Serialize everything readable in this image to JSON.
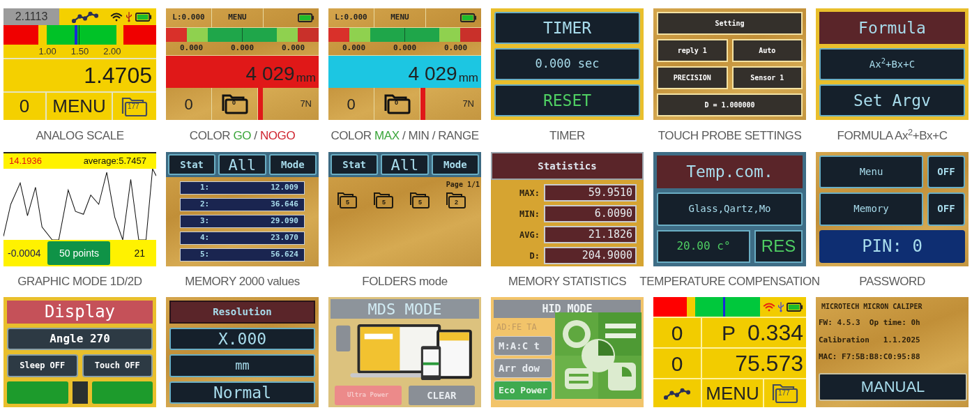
{
  "tiles": [
    {
      "kind": "analog",
      "readout": "2.1113",
      "scale_labels": [
        "1.00",
        "1.50",
        "2.00"
      ],
      "value": "1.4705",
      "zero": "0",
      "menu": "MENU",
      "folder": "177",
      "caption": [
        {
          "text": "ANALOG SCALE",
          "color": "#5b5b5b"
        }
      ]
    },
    {
      "kind": "nogo",
      "limit": "L:0.000",
      "menu": "MENU",
      "limits": [
        "0.000",
        "0.000",
        "0.000"
      ],
      "value": "4 029",
      "unit": "mm",
      "zero": "0",
      "folder": "0",
      "right": "7N",
      "caption": [
        {
          "text": "COLOR ",
          "color": "#5b5b5b"
        },
        {
          "text": "GO",
          "color": "#3aa53a"
        },
        {
          "text": " / ",
          "color": "#5b5b5b"
        },
        {
          "text": "NOGO",
          "color": "#cf2530"
        }
      ]
    },
    {
      "kind": "range",
      "limit": "L:0.000",
      "menu": "MENU",
      "limits": [
        "0.000",
        "0.000",
        "0.000"
      ],
      "value": "4 029",
      "unit": "mm",
      "zero": "0",
      "folder": "0",
      "right": "7N",
      "caption": [
        {
          "text": "COLOR ",
          "color": "#5b5b5b"
        },
        {
          "text": "MAX",
          "color": "#3aa53a"
        },
        {
          "text": " / MIN / RANGE",
          "color": "#5b5b5b"
        }
      ]
    },
    {
      "kind": "panel",
      "rows": [
        [
          {
            "text": "TIMER",
            "kind": "heading"
          }
        ],
        [
          {
            "text": "0.000 sec",
            "kind": "value"
          }
        ],
        [
          {
            "text": "RESET",
            "kind": "action"
          }
        ]
      ],
      "caption": [
        {
          "text": "TIMER",
          "color": "#5b5b5b"
        }
      ]
    },
    {
      "kind": "panel",
      "rows": [
        [
          {
            "text": "Setting",
            "kind": "plate"
          }
        ],
        [
          {
            "text": "reply 1",
            "kind": "plate"
          },
          {
            "text": "Auto",
            "kind": "plate"
          }
        ],
        [
          {
            "text": "PRECISION",
            "kind": "plate"
          },
          {
            "text": "Sensor 1",
            "kind": "plate"
          }
        ],
        [
          {
            "text": "D = 1.000000",
            "kind": "plate"
          }
        ]
      ],
      "caption": [
        {
          "text": "TOUCH PROBE SETTINGS",
          "color": "#5b5b5b"
        }
      ]
    },
    {
      "kind": "panel",
      "rows": [
        [
          {
            "text": "Formula",
            "kind": "banner"
          }
        ],
        [
          {
            "text": "Ax$^{2}$+Bx+C",
            "kind": "label"
          }
        ],
        [
          {
            "text": "Set Argv",
            "kind": "heading"
          }
        ]
      ],
      "caption": [
        {
          "text": "FORMULA Ax$^{2}$+Bx+C",
          "color": "#5b5b5b"
        }
      ]
    },
    {
      "kind": "graph",
      "max": "14.1936",
      "average": "average:5.7457",
      "min": "-0.0004",
      "points": "50 points",
      "count": "21",
      "caption": [
        {
          "text": "GRAPHIC MODE 1D/2D",
          "color": "#5b5b5b"
        }
      ]
    },
    {
      "kind": "memory",
      "header": [
        "Stat",
        "All",
        "Mode"
      ],
      "entries": [
        {
          "index": "1:",
          "value": "12.009"
        },
        {
          "index": "2:",
          "value": "36.646"
        },
        {
          "index": "3:",
          "value": "29.090"
        },
        {
          "index": "4:",
          "value": "23.070"
        },
        {
          "index": "5:",
          "value": "56.624"
        }
      ],
      "caption": [
        {
          "text": "MEMORY 2000 values",
          "color": "#5b5b5b"
        }
      ]
    },
    {
      "kind": "folders",
      "header": [
        "Stat",
        "All",
        "Mode"
      ],
      "page": "Page 1/1",
      "folders": [
        "5",
        "5",
        "5",
        "2"
      ],
      "caption": [
        {
          "text": "FOLDERS mode",
          "color": "#5b5b5b"
        }
      ]
    },
    {
      "kind": "stats",
      "title": "Statistics",
      "stats": [
        {
          "label": "MAX:",
          "value": "59.9510"
        },
        {
          "label": "MIN:",
          "value": "6.0090"
        },
        {
          "label": "AVG:",
          "value": "21.1826"
        },
        {
          "label": "D:",
          "value": "204.9000"
        }
      ],
      "caption": [
        {
          "text": "MEMORY STATISTICS",
          "color": "#5b5b5b"
        }
      ]
    },
    {
      "kind": "panel",
      "rows": [
        [
          {
            "text": "Temp.com.",
            "kind": "banner"
          }
        ],
        [
          {
            "text": "Glass,Qartz,Mo",
            "kind": "label"
          }
        ],
        [
          {
            "text": "20.00 c°",
            "kind": "reading"
          },
          {
            "text": "RES",
            "kind": "reset"
          }
        ]
      ],
      "caption": [
        {
          "text": "TEMPERATURE COMPENSATION",
          "color": "#5b5b5b"
        }
      ]
    },
    {
      "kind": "panel",
      "rows": [
        [
          {
            "text": "Menu",
            "kind": "label"
          },
          {
            "text": "OFF",
            "kind": "toggle"
          }
        ],
        [
          {
            "text": "Memory",
            "kind": "label"
          },
          {
            "text": "OFF",
            "kind": "toggle"
          }
        ],
        [
          {
            "text": "PIN: 0",
            "kind": "pin"
          }
        ]
      ],
      "caption": [
        {
          "text": "PASSWORD",
          "color": "#5b5b5b"
        }
      ]
    },
    {
      "kind": "panel",
      "rows": [
        [
          {
            "text": "Display",
            "kind": "headline"
          }
        ],
        [
          {
            "text": "Angle 270",
            "kind": "setting"
          }
        ],
        [
          {
            "text": "Sleep OFF",
            "kind": "option"
          },
          {
            "text": "Touch OFF",
            "kind": "option"
          }
        ],
        [
          {
            "kind": "block"
          },
          {
            "kind": "slot"
          },
          {
            "kind": "block"
          }
        ]
      ]
    },
    {
      "kind": "panel",
      "rows": [
        [
          {
            "text": "Resolution",
            "kind": "header"
          }
        ],
        [
          {
            "text": "X.000",
            "kind": "heading"
          }
        ],
        [
          {
            "text": "mm",
            "kind": "value"
          }
        ],
        [
          {
            "text": "Normal",
            "kind": "heading"
          }
        ]
      ]
    },
    {
      "kind": "mds",
      "title": "MDS MODE",
      "buttons": [
        {
          "text": "Ultra Power",
          "kind": "power"
        },
        {
          "text": "CLEAR",
          "kind": "plain"
        }
      ]
    },
    {
      "kind": "hid",
      "title": "HID MODE",
      "address": "AD:FE TA",
      "buttons": [
        {
          "text": "M:A:C t",
          "kind": "plain"
        },
        {
          "text": "Arr dow",
          "kind": "plain"
        },
        {
          "text": "Eco Power",
          "kind": "eco"
        }
      ]
    },
    {
      "kind": "dual",
      "rows": [
        {
          "zero": "0",
          "mode": "P",
          "value": "0.334"
        },
        {
          "zero": "0",
          "value": "75.573"
        }
      ],
      "menu": "MENU",
      "folder": "177"
    },
    {
      "kind": "info",
      "lines": [
        "MICROTECH MICRON CALIPER",
        "FW: 4.5.3  Op time: 0h",
        "Calibration   1.1.2025",
        "MAC: F7:5B:B8:C0:95:88"
      ],
      "button": "MANUAL"
    }
  ]
}
